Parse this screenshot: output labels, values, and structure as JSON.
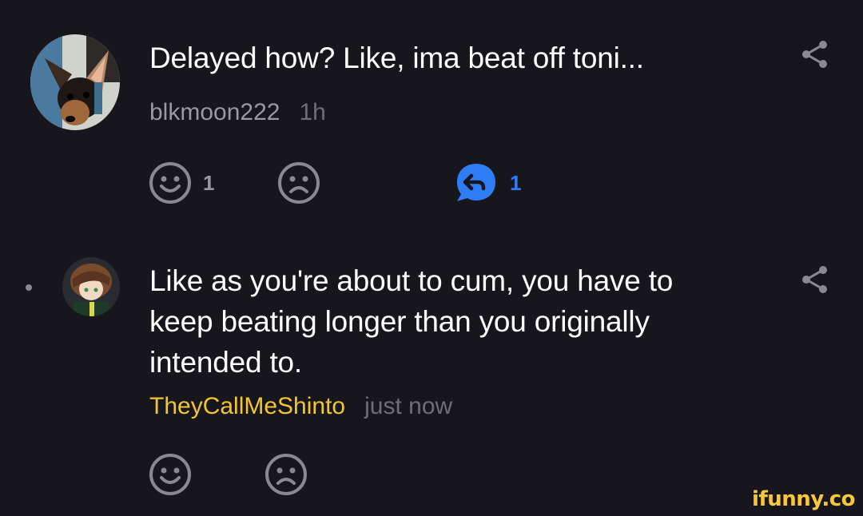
{
  "comments": [
    {
      "text": "Delayed how? Like, ima beat off toni...",
      "username": "blkmoon222",
      "time": "1h",
      "username_color": "#9a99a2",
      "reactions": {
        "smile_count": "1",
        "frown_count": "",
        "reply_count": "1"
      }
    },
    {
      "text": "Like as you're about to cum, you have to keep beating longer than you originally intended to.",
      "username": "TheyCallMeShinto",
      "time": "just now",
      "username_color": "#f3c630"
    }
  ],
  "icons": {
    "share": "share-icon",
    "smile": "smile-icon",
    "frown": "frown-icon",
    "reply": "reply-bubble-icon"
  },
  "colors": {
    "background": "#17161c",
    "icon_gray": "#8a8990",
    "reply_blue": "#2f7df6",
    "highlight_username": "#f3c630"
  },
  "watermark": "ifunny.co"
}
